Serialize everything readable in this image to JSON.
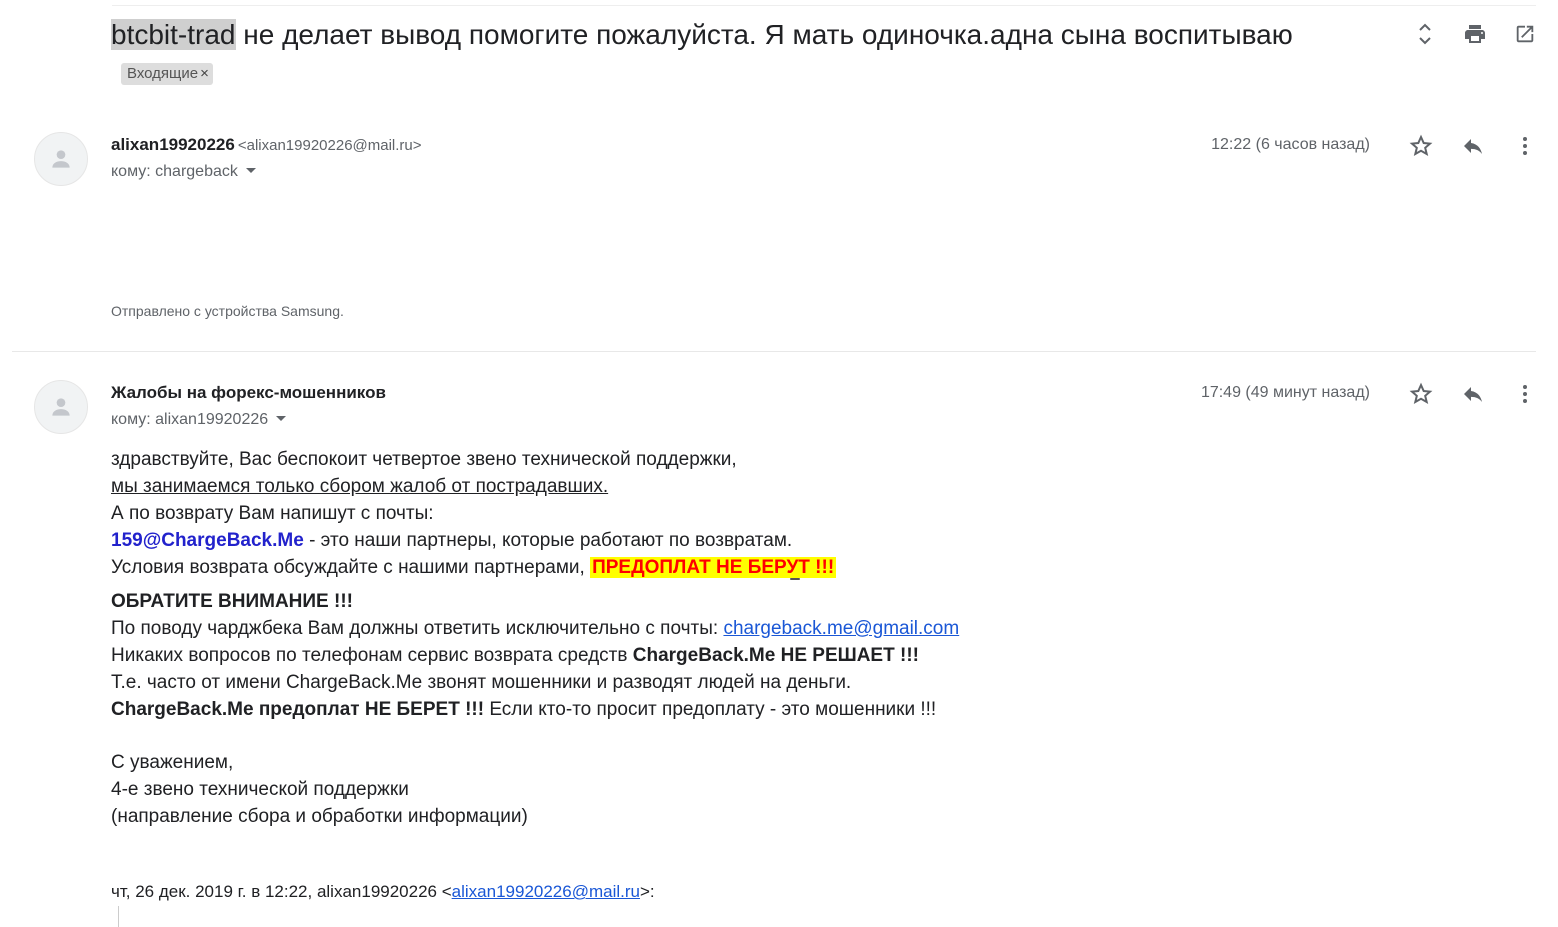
{
  "header": {
    "subject_highlight": "btcbit-trad",
    "subject_rest": " не делает вывод помогите пожалуйста. Я мать одиночка.адна сына воспитываю",
    "label": "Входящие",
    "label_close": "×"
  },
  "messages": [
    {
      "sender_name": "alixan19920226",
      "sender_email": "<alixan19920226@mail.ru>",
      "to_line": "кому: chargeback",
      "time": "12:22 (6 часов назад)",
      "signature": "Отправлено с устройства Samsung."
    },
    {
      "sender_name": "Жалобы на форекс-мошенников",
      "to_line": "кому: alixan19920226",
      "time": "17:49 (49 минут назад)",
      "body": {
        "line1": "здравствуйте, Вас беспокоит четвертое звено технической поддержки,",
        "line2": "мы занимаемся только сбором жалоб от пострадавших.",
        "line3": "А по возврату Вам напишут с почты:",
        "line4_email": "159@ChargeBack.Me",
        "line4_rest": " - это наши партнеры, которые работают по возвратам.",
        "line5_text": "Условия возврата обсуждайте с нашими партнерами, ",
        "line5_warn": "ПРЕДОПЛАТ НЕ БЕРУТ !!!",
        "attention": "ОБРАТИТЕ ВНИМАНИЕ !!!",
        "line7_text": "По поводу чарджбека Вам должны ответить исключительно с почты: ",
        "line7_link": "chargeback.me@gmail.com",
        "line8_text": "Никаких вопросов по телефонам сервис возврата средств ",
        "line8_bold": "ChargeBack.Me НЕ РЕШАЕТ !!!",
        "line9": "Т.е. часто от имени ChargeBack.Me звонят мошенники и разводят людей на деньги.",
        "line10_bold": "ChargeBack.Me предоплат НЕ БЕРЕТ !!!",
        "line10_rest": " Если кто-то просит предоплату - это мошенники !!!",
        "regards1": "С уважением,",
        "regards2": "4-е звено технической поддержки",
        "regards3": "(направление сбора и обработки информации)"
      },
      "quote_prefix": "чт, 26 дек. 2019 г. в 12:22, alixan19920226 <",
      "quote_link": "alixan19920226@mail.ru",
      "quote_suffix": ">:"
    }
  ],
  "icons": {
    "expand": "unfold-icon",
    "print": "print-icon",
    "open_new": "open-in-new-icon",
    "star": "star-icon",
    "reply": "reply-icon",
    "more": "more-vert-icon"
  }
}
